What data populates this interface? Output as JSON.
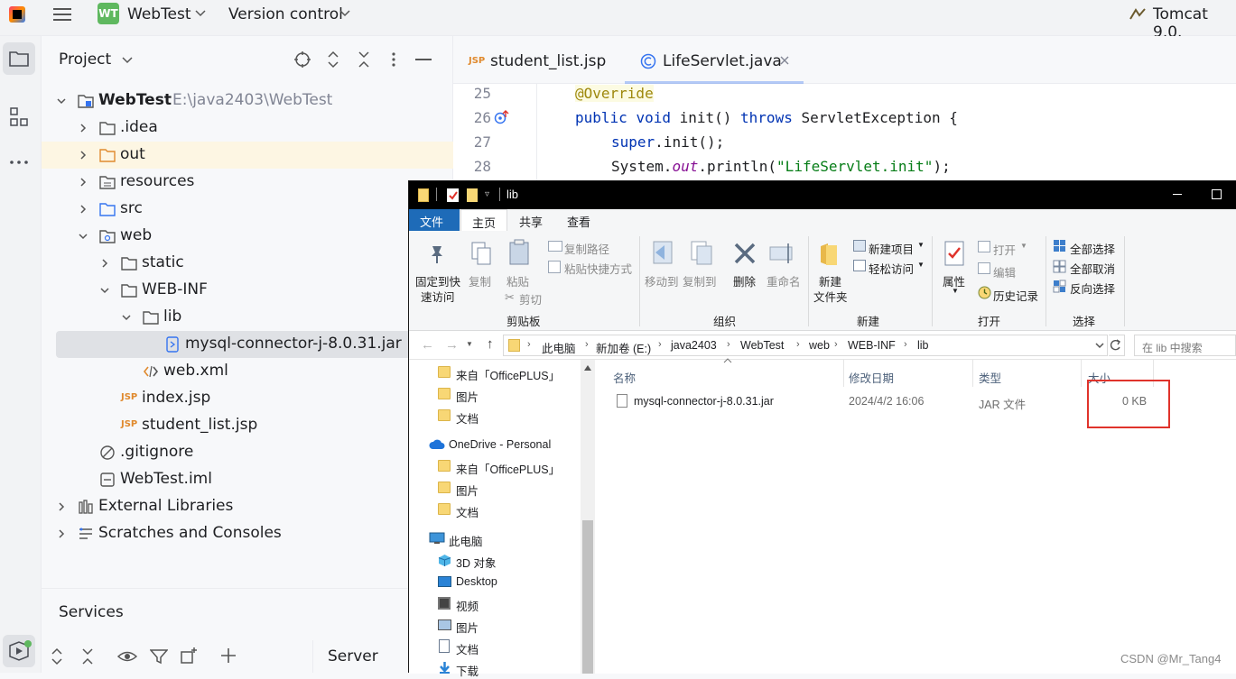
{
  "ide": {
    "project_name": "WebTest",
    "project_badge": "WT",
    "vcs_label": "Version control",
    "run_config": "Tomcat 9.0.",
    "project_panel_title": "Project",
    "services_title": "Services",
    "server_tab": "Server",
    "tree": [
      {
        "label": "WebTest",
        "extra": "E:\\java2403\\WebTest"
      },
      {
        "label": ".idea"
      },
      {
        "label": "out"
      },
      {
        "label": "resources"
      },
      {
        "label": "src"
      },
      {
        "label": "web"
      },
      {
        "label": "static"
      },
      {
        "label": "WEB-INF"
      },
      {
        "label": "lib"
      },
      {
        "label": "mysql-connector-j-8.0.31.jar"
      },
      {
        "label": "web.xml"
      },
      {
        "label": "index.jsp"
      },
      {
        "label": "student_list.jsp"
      },
      {
        "label": ".gitignore"
      },
      {
        "label": "WebTest.iml"
      },
      {
        "label": "External Libraries"
      },
      {
        "label": "Scratches and Consoles"
      }
    ],
    "tabs": [
      {
        "label": "student_list.jsp",
        "badge": "JSP"
      },
      {
        "label": "LifeServlet.java",
        "badge": "C"
      }
    ],
    "jsp_badge": "JSP",
    "code": {
      "l25": {
        "num": "25",
        "annotation": "@Override"
      },
      "l26": {
        "num": "26",
        "kw1": "public",
        "kw2": "void",
        "name": " init() ",
        "kw3": "throws",
        "rest": " ServletException {"
      },
      "l27": {
        "num": "27",
        "kw": "super",
        "rest": ".init();"
      },
      "l28": {
        "num": "28",
        "a": "System.",
        "b": "out",
        "c": ".println(",
        "d": "\"LifeServlet.init\"",
        "e": ");"
      }
    }
  },
  "explorer": {
    "title": "lib",
    "menu": [
      "文件",
      "主页",
      "共享",
      "查看"
    ],
    "ribbon": {
      "pin": [
        "固定到快",
        "速访问"
      ],
      "copy": "复制",
      "paste": "粘贴",
      "copy_path": "复制路径",
      "paste_shortcut": "粘贴快捷方式",
      "cut": "剪切",
      "clipboard_group": "剪贴板",
      "move_to": "移动到",
      "copy_to": "复制到",
      "delete": "删除",
      "rename": "重命名",
      "organize_group": "组织",
      "new_folder": [
        "新建",
        "文件夹"
      ],
      "new_item": "新建项目",
      "easy_access": "轻松访问",
      "new_group": "新建",
      "properties": "属性",
      "open": "打开",
      "edit": "编辑",
      "history": "历史记录",
      "open_group": "打开",
      "select_all": "全部选择",
      "select_none": "全部取消",
      "invert": "反向选择",
      "select_group": "选择"
    },
    "breadcrumb": [
      "此电脑",
      "新加卷 (E:)",
      "java2403",
      "WebTest",
      "web",
      "WEB-INF",
      "lib"
    ],
    "search_placeholder": "在 lib 中搜索",
    "nav": [
      "来自「OfficePLUS」",
      "图片",
      "文档",
      "OneDrive - Personal",
      "来自「OfficePLUS」",
      "图片",
      "文档",
      "此电脑",
      "3D 对象",
      "Desktop",
      "视频",
      "图片",
      "文档",
      "下载"
    ],
    "columns": [
      "名称",
      "修改日期",
      "类型",
      "大小"
    ],
    "files": [
      {
        "name": "mysql-connector-j-8.0.31.jar",
        "date": "2024/4/2 16:06",
        "type": "JAR 文件",
        "size": "0 KB"
      }
    ],
    "highlight_color": "#e0332b"
  },
  "watermark": "CSDN @Mr_Tang4"
}
